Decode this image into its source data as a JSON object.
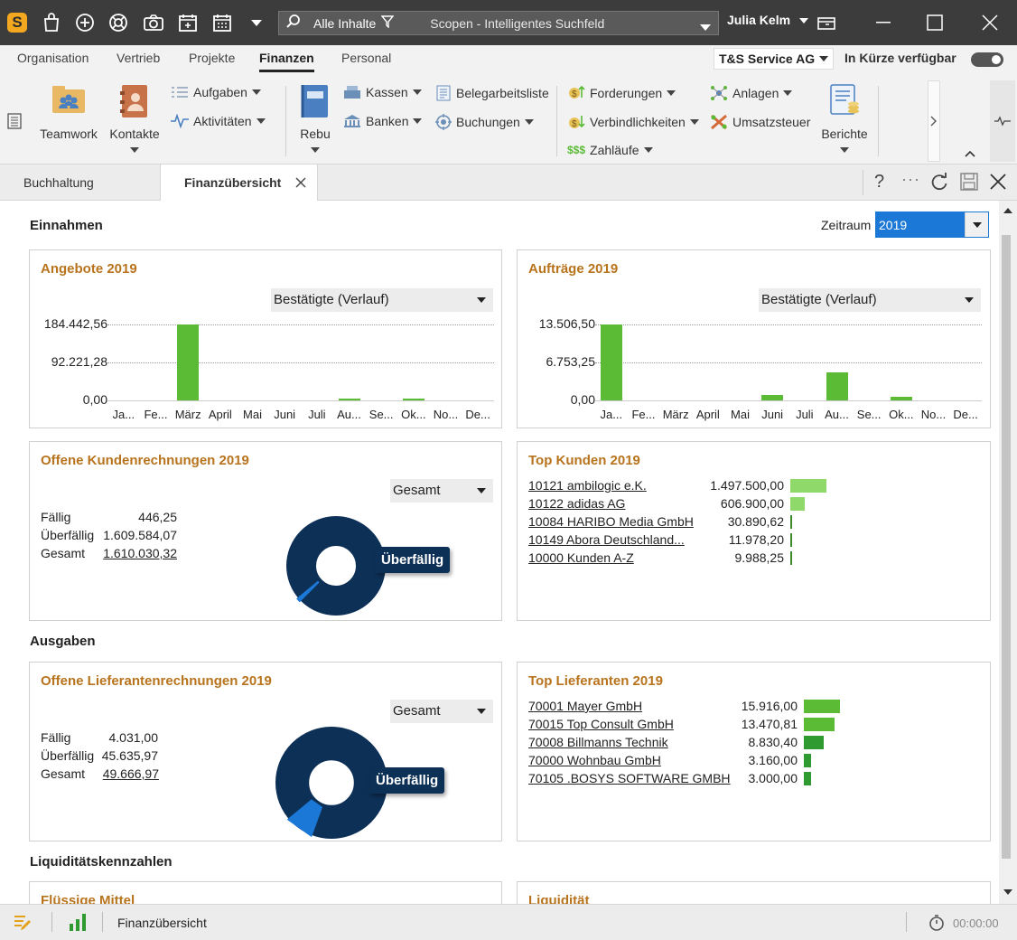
{
  "search": {
    "scope_label": "Alle Inhalte",
    "placeholder": "Scopen - Intelligentes Suchfeld"
  },
  "user": {
    "name": "Julia Kelm"
  },
  "menu": {
    "items": [
      "Organisation",
      "Vertrieb",
      "Projekte",
      "Finanzen",
      "Personal"
    ],
    "active": "Finanzen"
  },
  "company": {
    "name": "T&S Service AG"
  },
  "feature_toggle": {
    "label": "In Kürze verfügbar"
  },
  "ribbon": {
    "teamwork": "Teamwork",
    "kontakte": "Kontakte",
    "aufgaben": "Aufgaben",
    "aktivitaeten": "Aktivitäten",
    "rebu": "Rebu",
    "kassen": "Kassen",
    "banken": "Banken",
    "belegarbeitsliste": "Belegarbeitsliste",
    "buchungen": "Buchungen",
    "forderungen": "Forderungen",
    "verbindlichkeiten": "Verbindlichkeiten",
    "zahllaeufe": "Zahläufe",
    "anlagen": "Anlagen",
    "umsatzsteuer": "Umsatzsteuer",
    "berichte": "Berichte"
  },
  "tabs": {
    "buchhaltung": "Buchhaltung",
    "finanzuebersicht": "Finanzübersicht"
  },
  "main": {
    "einnahmen": "Einnahmen",
    "zeitraum_label": "Zeitraum",
    "zeitraum_value": "2019",
    "ausgaben": "Ausgaben",
    "liquiditaet_header": "Liquiditätskennzahlen",
    "fluessige_mittel": "Flüssige Mittel",
    "liquiditaet": "Liquidität"
  },
  "chart_data": [
    {
      "type": "bar",
      "title": "Angebote 2019",
      "filter": "Bestätigte (Verlauf)",
      "categories": [
        "Ja...",
        "Fe...",
        "März",
        "April",
        "Mai",
        "Juni",
        "Juli",
        "Au...",
        "Se...",
        "Ok...",
        "No...",
        "De..."
      ],
      "values": [
        0,
        0,
        184442.56,
        0,
        0,
        0,
        0,
        800,
        0,
        2500,
        0,
        0
      ],
      "yticks": [
        "184.442,56",
        "92.221,28",
        "0,00"
      ],
      "ylim": [
        0,
        184442.56
      ],
      "color": "#5bbb35"
    },
    {
      "type": "bar",
      "title": "Aufträge 2019",
      "filter": "Bestätigte (Verlauf)",
      "categories": [
        "Ja...",
        "Fe...",
        "März",
        "April",
        "Mai",
        "Juni",
        "Juli",
        "Au...",
        "Se...",
        "Ok...",
        "No...",
        "De..."
      ],
      "values": [
        13506.5,
        0,
        0,
        0,
        0,
        900,
        0,
        5000,
        0,
        700,
        0,
        0
      ],
      "yticks": [
        "13.506,50",
        "6.753,25",
        "0,00"
      ],
      "ylim": [
        0,
        13506.5
      ],
      "color": "#5bbb35"
    }
  ],
  "offene_kunden": {
    "title": "Offene Kundenrechnungen 2019",
    "filter": "Gesamt",
    "rows": [
      {
        "label": "Fällig",
        "value": "446,25"
      },
      {
        "label": "Überfällig",
        "value": "1.609.584,07"
      },
      {
        "label": "Gesamt",
        "value": "1.610.030,32"
      }
    ],
    "donut_label": "Überfällig",
    "faellig_fraction": 0.0003
  },
  "top_kunden": {
    "title": "Top Kunden 2019",
    "rows": [
      {
        "name": "10121 ambilogic e.K.",
        "value": "1.497.500,00",
        "amount": 1497500
      },
      {
        "name": "10122 adidas AG",
        "value": "606.900,00",
        "amount": 606900
      },
      {
        "name": "10084 HARIBO Media GmbH",
        "value": "30.890,62",
        "amount": 30890.62
      },
      {
        "name": "10149 Abora Deutschland...",
        "value": "11.978,20",
        "amount": 11978.2
      },
      {
        "name": "10000 Kunden A-Z",
        "value": "9.988,25",
        "amount": 9988.25
      }
    ]
  },
  "offene_lieferanten": {
    "title": "Offene Lieferantenrechnungen 2019",
    "filter": "Gesamt",
    "rows": [
      {
        "label": "Fällig",
        "value": "4.031,00"
      },
      {
        "label": "Überfällig",
        "value": "45.635,97"
      },
      {
        "label": "Gesamt",
        "value": "49.666,97"
      }
    ],
    "donut_label": "Überfällig",
    "faellig_fraction": 0.081
  },
  "top_lieferanten": {
    "title": "Top Lieferanten 2019",
    "rows": [
      {
        "name": "70001 Mayer GmbH",
        "value": "15.916,00",
        "amount": 15916
      },
      {
        "name": "70015 Top Consult GmbH",
        "value": "13.470,81",
        "amount": 13470.81
      },
      {
        "name": "70008 Billmanns Technik",
        "value": "8.830,40",
        "amount": 8830.4
      },
      {
        "name": "70000 Wohnbau GmbH",
        "value": "3.160,00",
        "amount": 3160
      },
      {
        "name": "70105 .BOSYS SOFTWARE GMBH",
        "value": "3.000,00",
        "amount": 3000
      }
    ]
  },
  "status": {
    "page": "Finanzübersicht",
    "timer": "00:00:00"
  },
  "colors": {
    "accent_title": "#b8731d",
    "bar_green": "#5bbb35",
    "donut_navy": "#0d3057",
    "donut_blue": "#1b78d6",
    "dropdown_blue": "#1b78d6"
  }
}
